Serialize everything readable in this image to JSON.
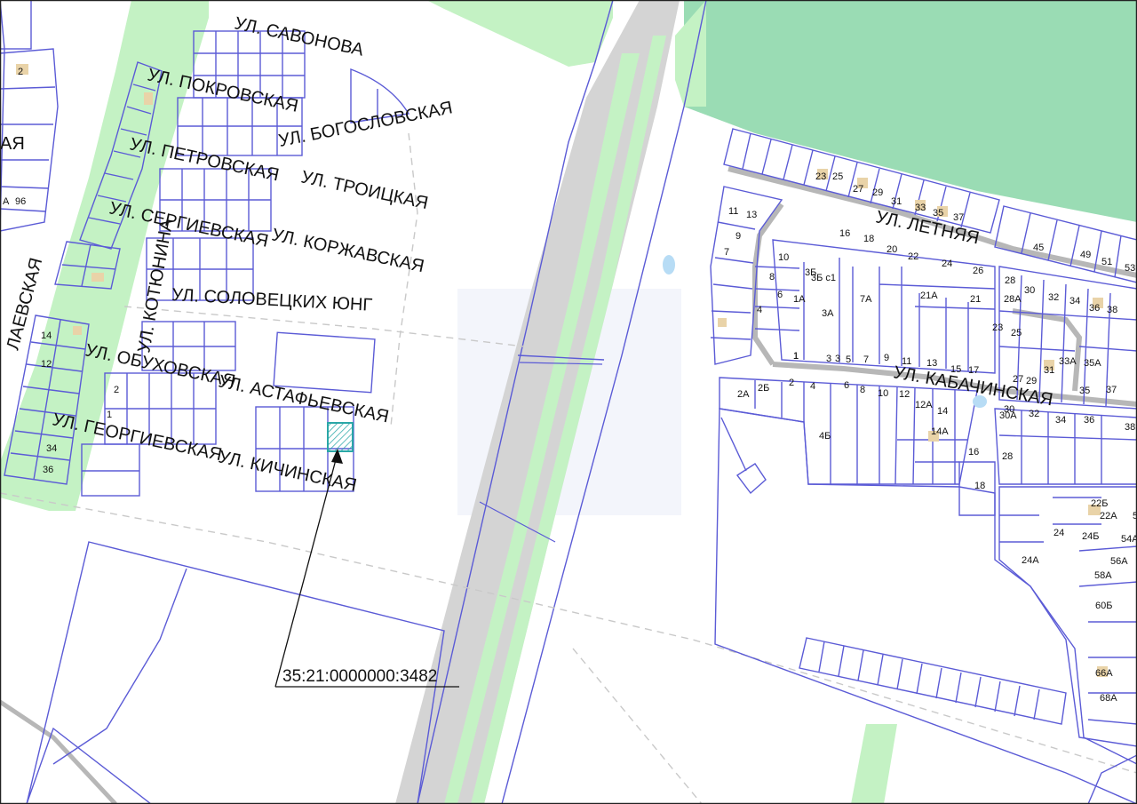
{
  "colors": {
    "green_strip": "#c4f2c4",
    "forest": "#9adcb4",
    "parcel_line": "#5b5bd6",
    "road_gray": "#b7b7b7",
    "highlight": "#2aa7a7",
    "building": "#e9d3a8"
  },
  "streets": {
    "savonova": "УЛ. САВОНОВА",
    "pokrovskaya": "УЛ. ПОКРОВСКАЯ",
    "bogoslovskaya": "УЛ. БОГОСЛОВСКАЯ",
    "petrovskaya": "УЛ. ПЕТРОВСКАЯ",
    "troitskaya": "УЛ. ТРОИЦКАЯ",
    "sergievskaya": "УЛ. СЕРГИЕВСКАЯ",
    "korzhavskaya": "УЛ. КОРЖАВСКАЯ",
    "solovetskih": "УЛ. СОЛОВЕЦКИХ ЮНГ",
    "kotyunina": "УЛ. КОТЮНИНА",
    "obuhovskaya": "УЛ. ОБУХОВСКАЯ",
    "astafevskaya": "УЛ. АСТАФЬЕВСКАЯ",
    "georgievskaya": "УЛ. ГЕОРГИЕВСКАЯ",
    "kichinskaya": "УЛ. КИЧИНСКАЯ",
    "nikolaevskaya": "ЛАЕВСКАЯ",
    "letnyaya": "УЛ. ЛЕТНЯЯ",
    "kabachinskaya": "УЛ. КАБАЧИНСКАЯ",
    "partial_ya": "АЯ"
  },
  "cadastral_number": "35:21:0000000:3482",
  "house_numbers_left": [
    "2",
    "96",
    "14",
    "12",
    "34",
    "36",
    "2",
    "1",
    "А"
  ],
  "house_numbers_right": [
    "23",
    "25",
    "27",
    "29",
    "31",
    "33",
    "35",
    "37",
    "11",
    "13",
    "9",
    "7",
    "16",
    "18",
    "20",
    "22",
    "24",
    "26",
    "45",
    "49",
    "51",
    "53",
    "10",
    "8",
    "6",
    "4",
    "3",
    "1",
    "3Б",
    "3Б с1",
    "1А",
    "3А",
    "7А",
    "21А",
    "21",
    "28",
    "30",
    "32",
    "34",
    "36",
    "38",
    "28А",
    "23",
    "25",
    "33А",
    "35А",
    "27",
    "29",
    "31",
    "35",
    "37",
    "1",
    "3",
    "5",
    "7",
    "9",
    "11",
    "13",
    "15",
    "17",
    "2А",
    "2Б",
    "2",
    "4",
    "6",
    "8",
    "10",
    "12",
    "12А",
    "14",
    "14А",
    "4Б",
    "30",
    "30А",
    "32",
    "34",
    "36",
    "38",
    "16",
    "28",
    "18",
    "22Б",
    "22А",
    "24",
    "24Б",
    "54А",
    "56А",
    "58А",
    "60Б",
    "24А",
    "66А",
    "68А",
    "5"
  ]
}
